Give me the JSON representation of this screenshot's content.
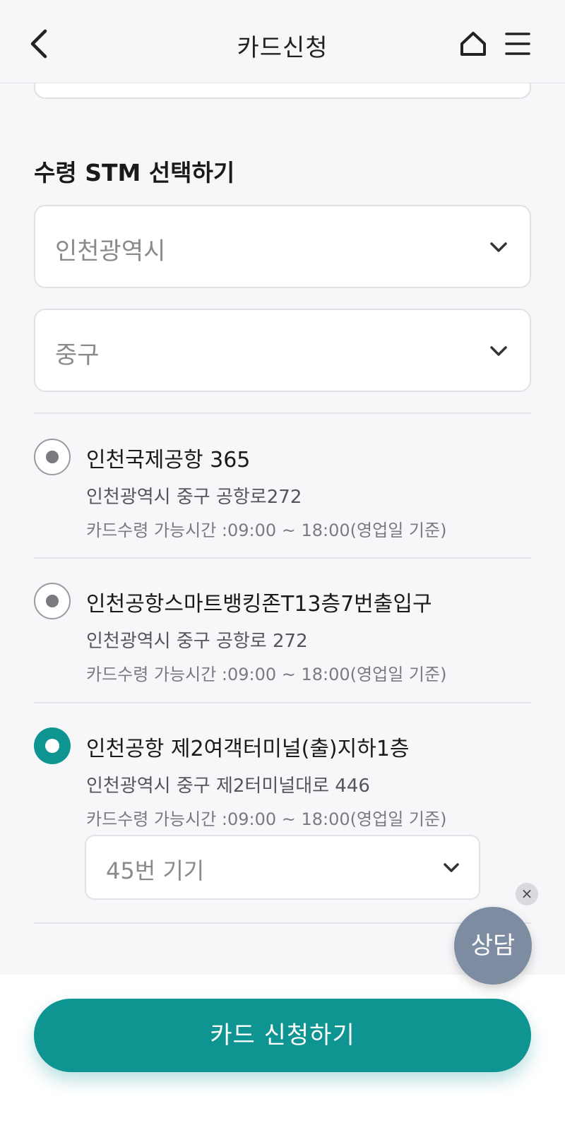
{
  "header": {
    "title": "카드신청",
    "back_icon": "chevron-left-icon",
    "home_icon": "home-icon",
    "menu_icon": "hamburger-menu-icon"
  },
  "section": {
    "title": "수령 STM 선택하기"
  },
  "filters": {
    "city": "인천광역시",
    "district": "중구"
  },
  "locations": [
    {
      "name": "인천국제공항 365",
      "address": "인천광역시 중구 공항로272",
      "hours": "카드수령 가능시간 :09:00 ~ 18:00(영업일 기준)",
      "selected": false
    },
    {
      "name": "인천공항스마트뱅킹존T13층7번출입구",
      "address": "인천광역시 중구 공항로 272",
      "hours": "카드수령 가능시간 :09:00 ~ 18:00(영업일 기준)",
      "selected": false
    },
    {
      "name": "인천공항 제2여객터미널(출)지하1층",
      "address": "인천광역시 중구 제2터미널대로 446",
      "hours": "카드수령 가능시간 :09:00 ~ 18:00(영업일 기준)",
      "selected": true
    }
  ],
  "machine": {
    "value": "45번 기기"
  },
  "fab": {
    "consult_label": "상담",
    "close_label": "×"
  },
  "footer": {
    "apply_label": "카드 신청하기"
  },
  "colors": {
    "accent": "#0f9591",
    "fab": "#7e8ca1"
  }
}
